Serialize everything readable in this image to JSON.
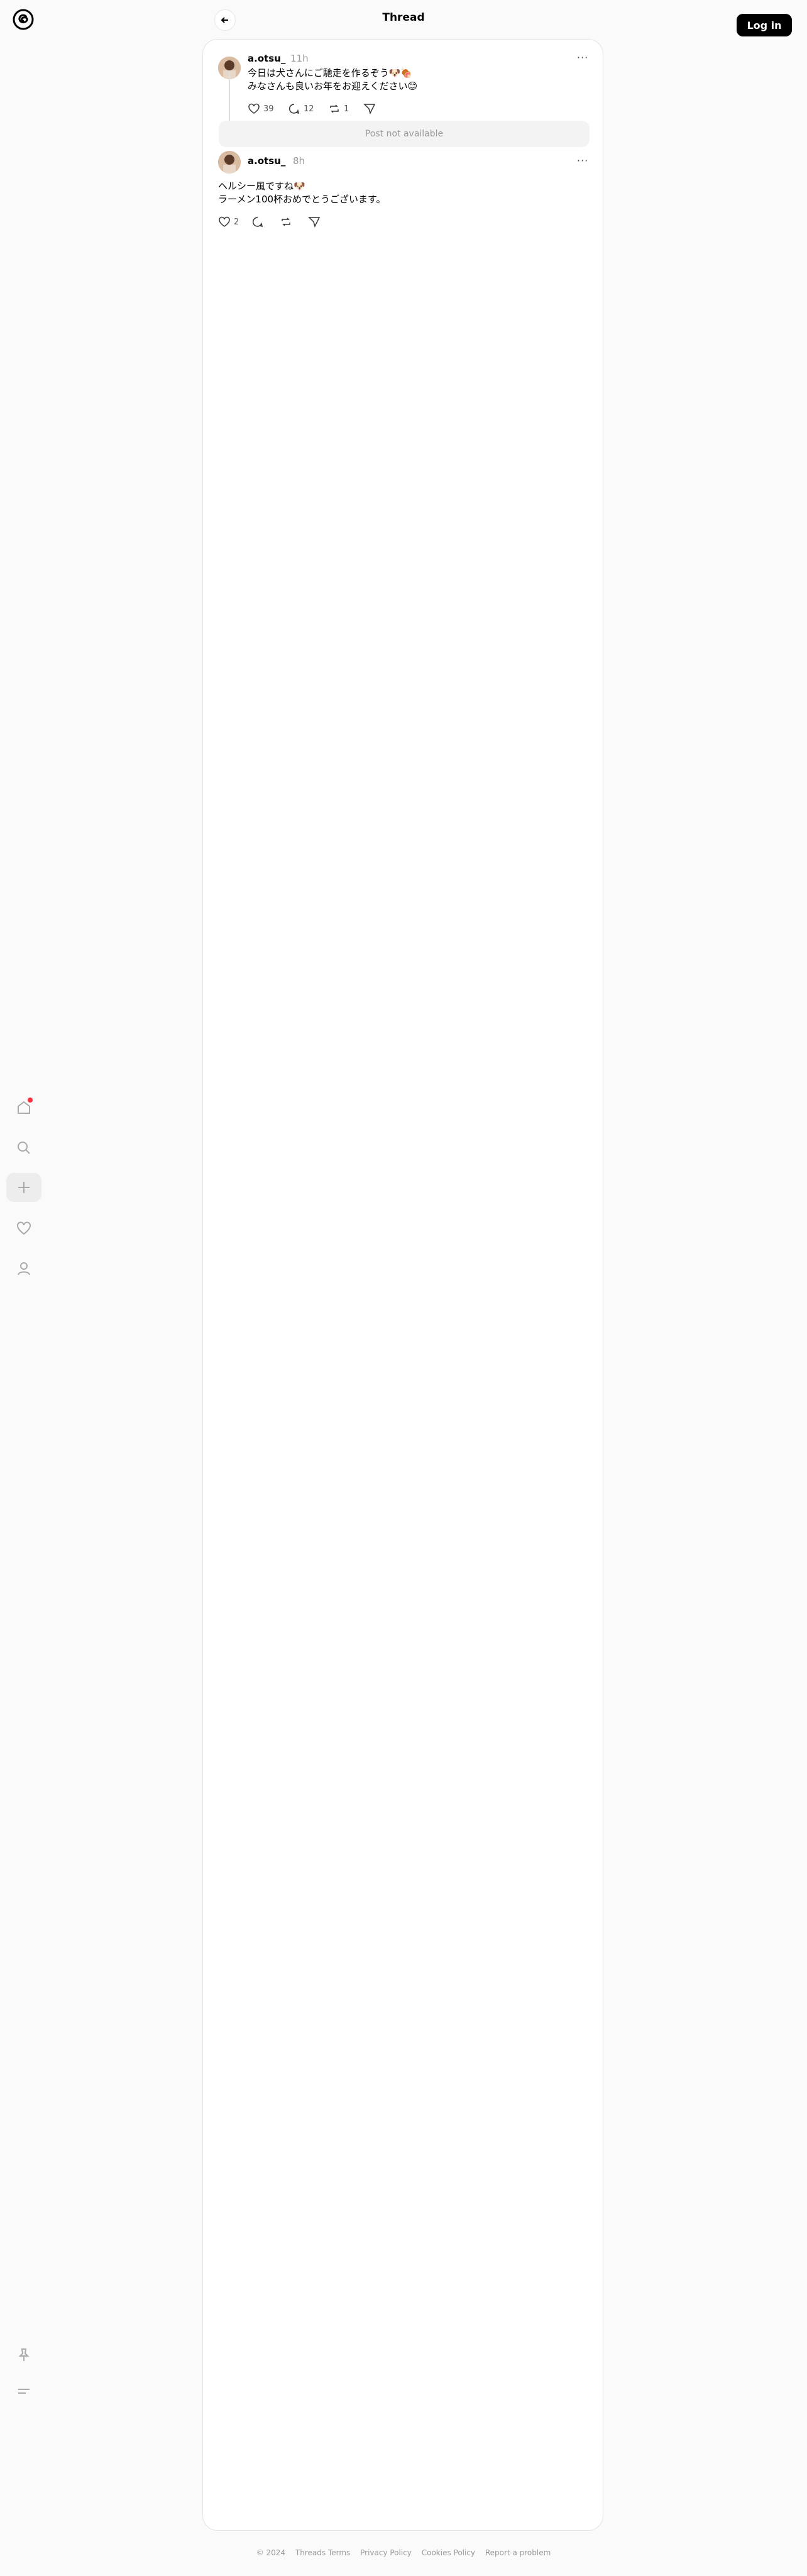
{
  "header": {
    "title": "Thread",
    "login_label": "Log in"
  },
  "sidebar": {
    "items": [
      "home-icon",
      "search-icon",
      "create-icon",
      "activity-icon",
      "profile-icon"
    ],
    "bottom": [
      "pin-icon",
      "menu-icon"
    ],
    "notification_color": "#ff3040"
  },
  "posts": [
    {
      "username": "a.otsu_",
      "time": "11h",
      "text": "今日は犬さんにご馳走を作るぞう🐶🍖\nみなさんも良いお年をお迎えください😊",
      "likes": "39",
      "replies": "12",
      "reposts": "1"
    },
    {
      "username": "a.otsu_",
      "time": "8h",
      "text": "ヘルシー風ですね🐶\nラーメン100杯おめでとうございます。",
      "likes": "2"
    }
  ],
  "unavailable_text": "Post not available",
  "footer": [
    "© 2024",
    "Threads Terms",
    "Privacy Policy",
    "Cookies Policy",
    "Report a problem"
  ]
}
